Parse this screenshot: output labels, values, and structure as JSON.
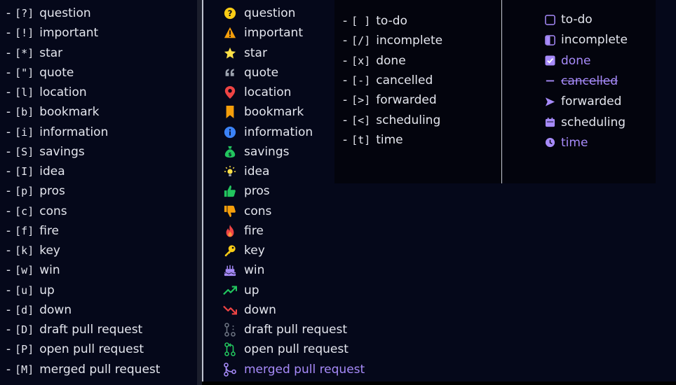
{
  "left_list": [
    {
      "code": "[?]",
      "label": "question"
    },
    {
      "code": "[!]",
      "label": "important"
    },
    {
      "code": "[*]",
      "label": "star"
    },
    {
      "code": "[\"]",
      "label": "quote"
    },
    {
      "code": "[l]",
      "label": "location"
    },
    {
      "code": "[b]",
      "label": "bookmark"
    },
    {
      "code": "[i]",
      "label": "information"
    },
    {
      "code": "[S]",
      "label": "savings"
    },
    {
      "code": "[I]",
      "label": "idea"
    },
    {
      "code": "[p]",
      "label": "pros"
    },
    {
      "code": "[c]",
      "label": "cons"
    },
    {
      "code": "[f]",
      "label": "fire"
    },
    {
      "code": "[k]",
      "label": "key"
    },
    {
      "code": "[w]",
      "label": "win"
    },
    {
      "code": "[u]",
      "label": "up"
    },
    {
      "code": "[d]",
      "label": "down"
    },
    {
      "code": "[D]",
      "label": "draft pull request"
    },
    {
      "code": "[P]",
      "label": "open pull request"
    },
    {
      "code": "[M]",
      "label": "merged pull request"
    }
  ],
  "icon_list": [
    {
      "label": "question",
      "icon": "question-icon",
      "color": "#facc15"
    },
    {
      "label": "important",
      "icon": "warning-icon",
      "color": "#f59e0b"
    },
    {
      "label": "star",
      "icon": "star-icon",
      "color": "#fde047"
    },
    {
      "label": "quote",
      "icon": "quote-icon",
      "color": "#9ca3af"
    },
    {
      "label": "location",
      "icon": "location-pin-icon",
      "color": "#ef4444"
    },
    {
      "label": "bookmark",
      "icon": "bookmark-icon",
      "color": "#f59e0b"
    },
    {
      "label": "information",
      "icon": "info-icon",
      "color": "#3b82f6"
    },
    {
      "label": "savings",
      "icon": "money-bag-icon",
      "color": "#22c55e"
    },
    {
      "label": "idea",
      "icon": "lightbulb-icon",
      "color": "#fde047"
    },
    {
      "label": "pros",
      "icon": "thumbs-up-icon",
      "color": "#22c55e"
    },
    {
      "label": "cons",
      "icon": "thumbs-down-icon",
      "color": "#f59e0b"
    },
    {
      "label": "fire",
      "icon": "fire-icon",
      "color": "#ef4444"
    },
    {
      "label": "key",
      "icon": "key-icon",
      "color": "#facc15"
    },
    {
      "label": "win",
      "icon": "cake-icon",
      "color": "#a78bfa"
    },
    {
      "label": "up",
      "icon": "trend-up-icon",
      "color": "#22c55e"
    },
    {
      "label": "down",
      "icon": "trend-down-icon",
      "color": "#ef4444"
    },
    {
      "label": "draft pull request",
      "icon": "git-pull-request-draft-icon",
      "color": "#6b7280"
    },
    {
      "label": "open pull request",
      "icon": "git-pull-request-icon",
      "color": "#22c55e"
    },
    {
      "label": "merged pull request",
      "icon": "git-merge-icon",
      "color": "#a78bfa"
    }
  ],
  "task_codes": [
    {
      "code": "[ ]",
      "label": "to-do"
    },
    {
      "code": "[/]",
      "label": "incomplete"
    },
    {
      "code": "[x]",
      "label": "done"
    },
    {
      "code": "[-]",
      "label": "cancelled"
    },
    {
      "code": "[>]",
      "label": "forwarded"
    },
    {
      "code": "[<]",
      "label": "scheduling"
    },
    {
      "code": "[t]",
      "label": "time"
    }
  ],
  "task_icons": [
    {
      "label": "to-do",
      "icon": "empty-checkbox-icon",
      "color": "#a78bfa"
    },
    {
      "label": "incomplete",
      "icon": "half-checkbox-icon",
      "color": "#a78bfa"
    },
    {
      "label": "done",
      "icon": "checked-checkbox-icon",
      "color": "#a78bfa"
    },
    {
      "label": "cancelled",
      "icon": "cancelled-dash-icon",
      "color": "#a78bfa"
    },
    {
      "label": "forwarded",
      "icon": "forward-arrow-icon",
      "color": "#a78bfa"
    },
    {
      "label": "scheduling",
      "icon": "calendar-icon",
      "color": "#a78bfa"
    },
    {
      "label": "time",
      "icon": "clock-icon",
      "color": "#a78bfa"
    }
  ],
  "theme": {
    "accent": "#a78bfa",
    "text": "#e4e6ee"
  }
}
